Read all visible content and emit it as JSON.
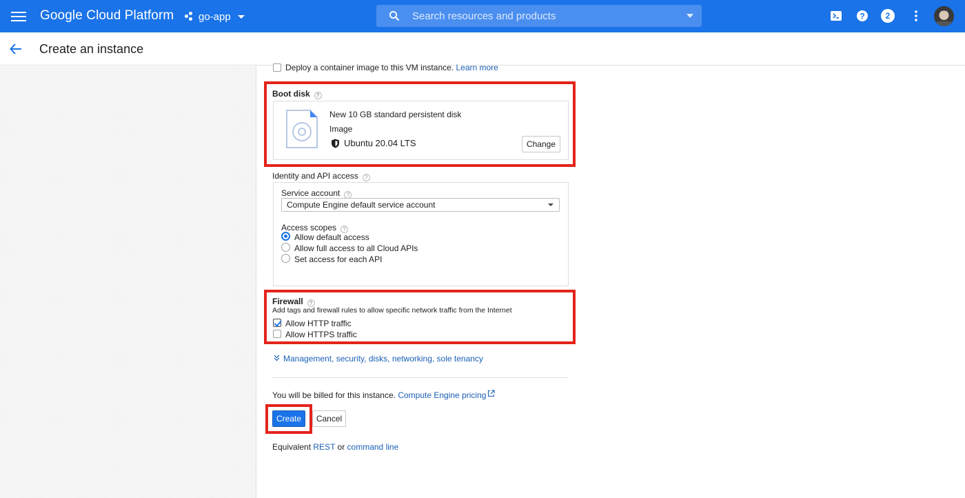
{
  "app": {
    "brand": "Google Cloud Platform",
    "project": "go-app",
    "search_placeholder": "Search resources and products",
    "notifications_count": "2",
    "accent_color": "#1a73e8"
  },
  "page": {
    "title": "Create an instance"
  },
  "container": {
    "label": "Deploy a container image to this VM instance.",
    "learn_more": "Learn more",
    "checked": false
  },
  "boot_disk": {
    "heading": "Boot disk",
    "disk_title": "New 10 GB standard persistent disk",
    "image_label": "Image",
    "image_name": "Ubuntu 20.04 LTS",
    "change_button": "Change"
  },
  "identity": {
    "heading": "Identity and API access",
    "service_account_label": "Service account",
    "service_account_value": "Compute Engine default service account",
    "access_scopes_label": "Access scopes",
    "scopes": [
      {
        "label": "Allow default access",
        "selected": true
      },
      {
        "label": "Allow full access to all Cloud APIs",
        "selected": false
      },
      {
        "label": "Set access for each API",
        "selected": false
      }
    ]
  },
  "firewall": {
    "heading": "Firewall",
    "description": "Add tags and firewall rules to allow specific network traffic from the Internet",
    "options": [
      {
        "label": "Allow HTTP traffic",
        "checked": true
      },
      {
        "label": "Allow HTTPS traffic",
        "checked": false
      }
    ]
  },
  "more_link": "Management, security, disks, networking, sole tenancy",
  "billing": {
    "text": "You will be billed for this instance.",
    "pricing_link": "Compute Engine pricing"
  },
  "actions": {
    "create": "Create",
    "cancel": "Cancel"
  },
  "equivalent": {
    "prefix": "Equivalent",
    "rest": "REST",
    "or": "or",
    "command_line": "command line"
  }
}
